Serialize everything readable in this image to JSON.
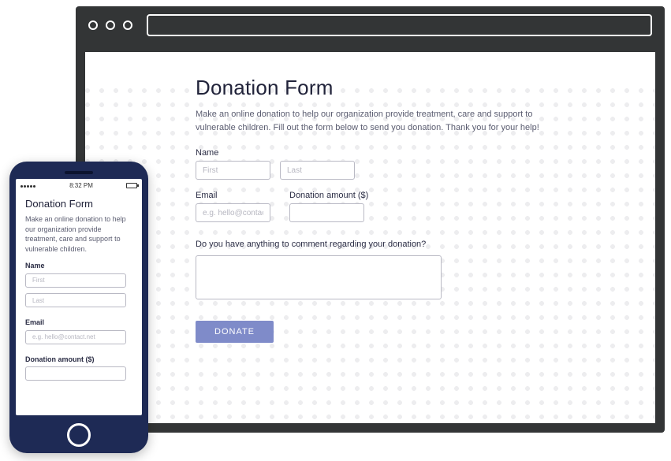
{
  "desktop": {
    "title": "Donation Form",
    "description": "Make an online donation to help our organization provide treatment, care and support to vulnerable children.\nFill out the form below to send you donation. Thank you for your help!",
    "name_label": "Name",
    "first_placeholder": "First",
    "last_placeholder": "Last",
    "email_label": "Email",
    "email_placeholder": "e.g. hello@contact.net",
    "amount_label": "Donation  amount ($)",
    "comment_label": "Do you have anything to comment regarding your donation?",
    "button_label": "DONATE"
  },
  "mobile": {
    "status_time": "8:32 PM",
    "title": "Donation Form",
    "description": "Make an online donation to help our organization provide treatment, care and support to vulnerable children.",
    "name_label": "Name",
    "first_placeholder": "First",
    "last_placeholder": "Last",
    "email_label": "Email",
    "email_placeholder": "e.g. hello@contact.net",
    "amount_label": "Donation amount ($)"
  },
  "colors": {
    "accent": "#7f8bc9",
    "phone_body": "#1e2a55",
    "browser_chrome": "#333536"
  }
}
